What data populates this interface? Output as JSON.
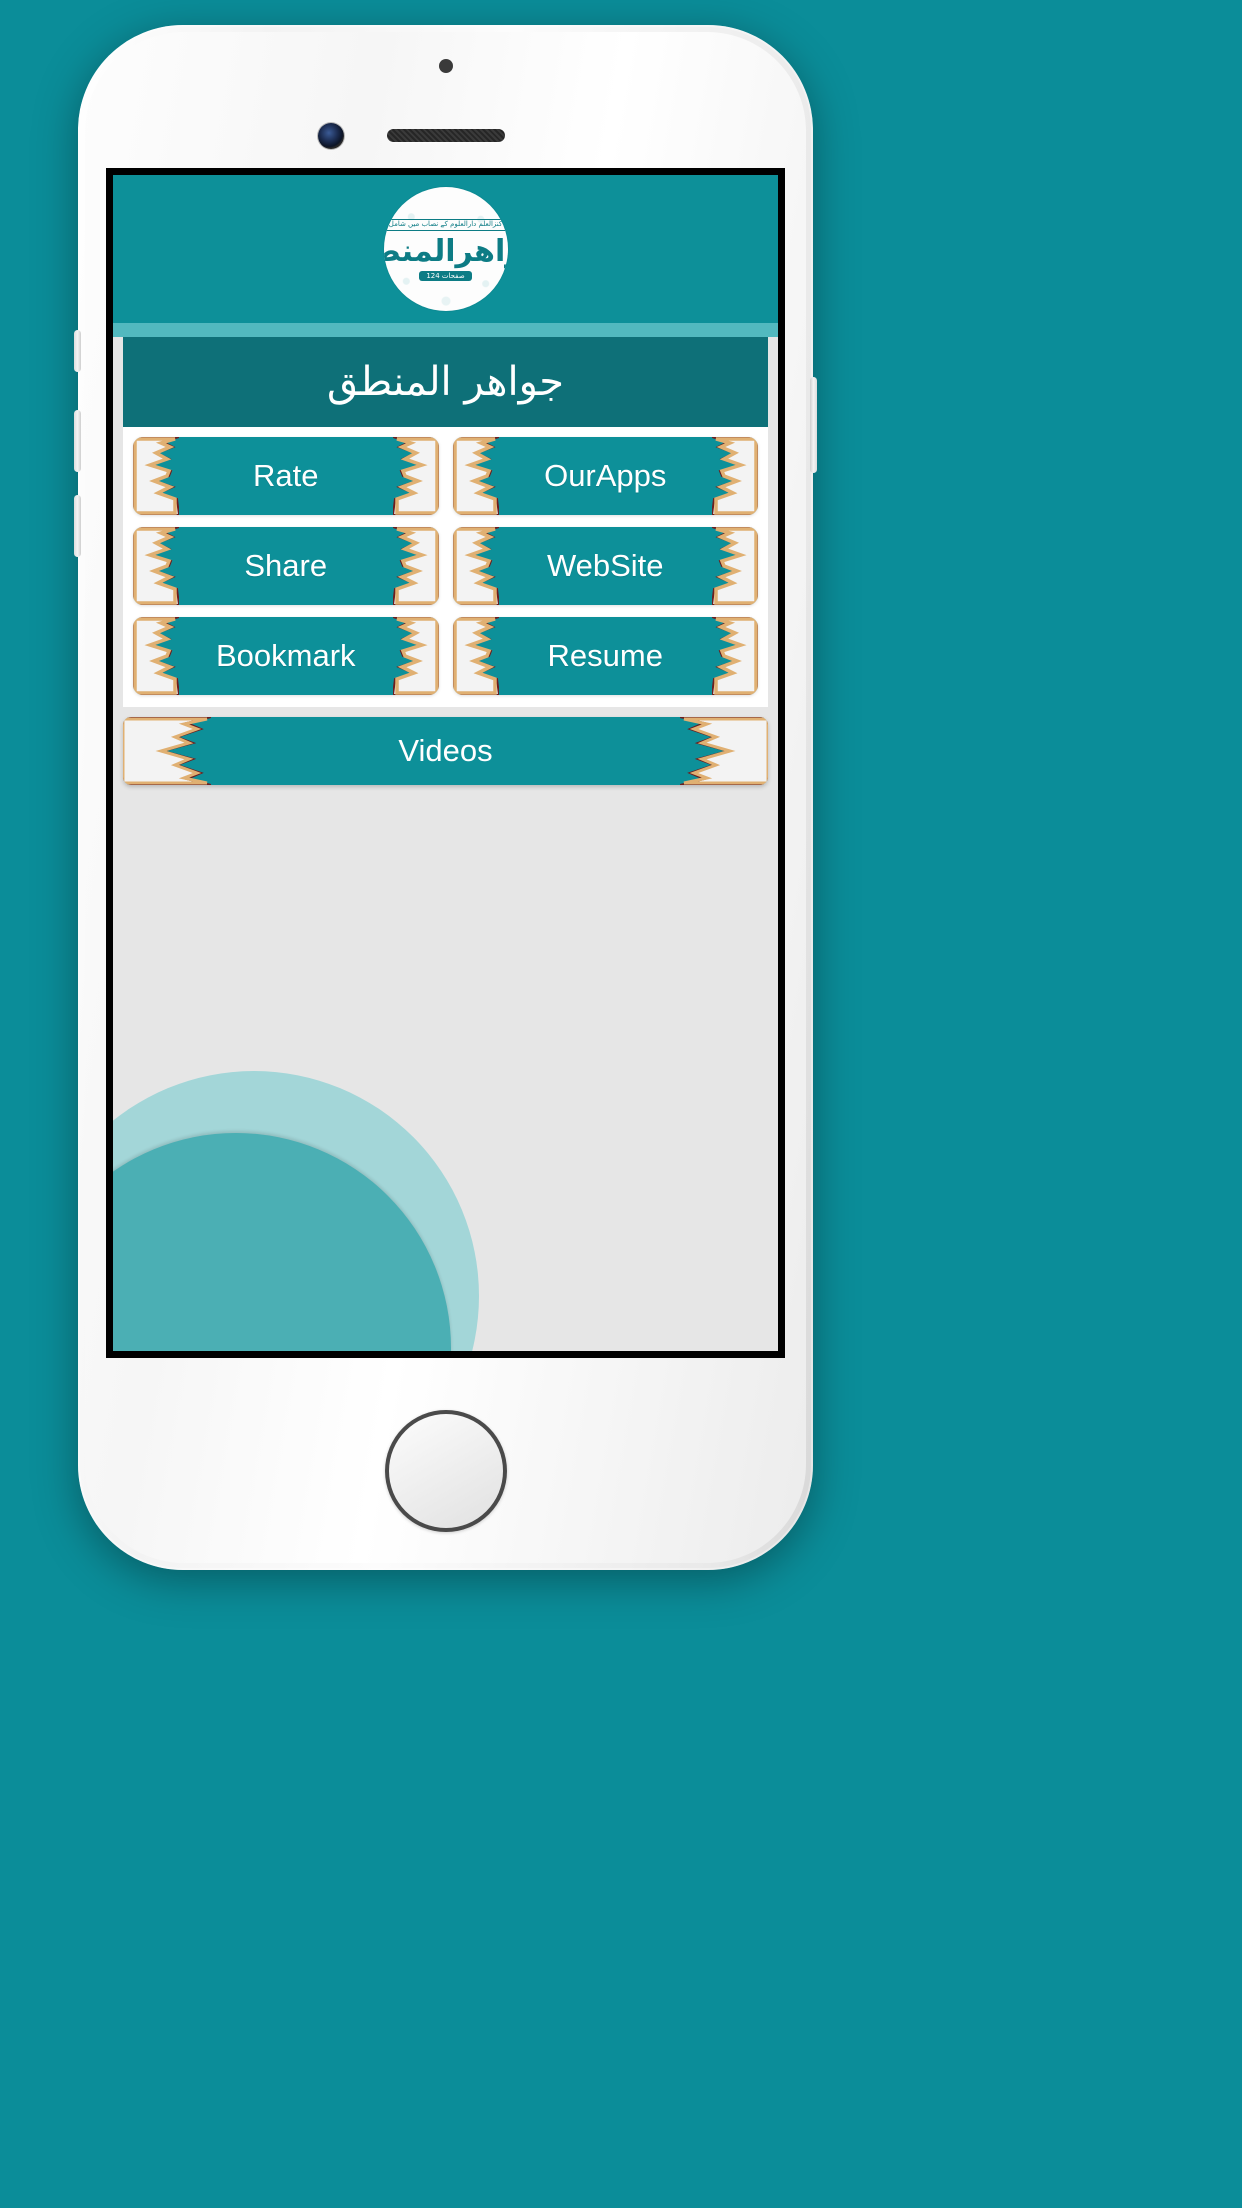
{
  "app": {
    "title_urdu": "جواهر المنطق",
    "logo": {
      "top_banner_text": "كنزالعلم دارالعلوم كے نصاب میں شامل",
      "main_text": "جواهرالمنطق",
      "bottom_badge_text": "صفحات 124"
    }
  },
  "menu": {
    "rows": [
      [
        {
          "label": "Rate",
          "name": "rate-button"
        },
        {
          "label": "OurApps",
          "name": "ourapps-button"
        }
      ],
      [
        {
          "label": "Share",
          "name": "share-button"
        },
        {
          "label": "WebSite",
          "name": "website-button"
        }
      ],
      [
        {
          "label": "Bookmark",
          "name": "bookmark-button"
        },
        {
          "label": "Resume",
          "name": "resume-button"
        }
      ]
    ],
    "videos": {
      "label": "Videos"
    }
  },
  "theme": {
    "teal": "#0d9099",
    "teal_dark": "#0e7078",
    "teal_accent": "#52b9bf",
    "gold": "#e0b072",
    "maroon": "#6b1f20",
    "screen_bg": "#e6e6e6",
    "page_bg": "#0b8d99",
    "circle_outer": "#a3d6d8",
    "circle_inner": "#4bafb4"
  },
  "device": {
    "icons": {
      "earpiece": "speaker-grille-icon",
      "camera": "front-camera-icon",
      "sensor": "proximity-sensor-icon",
      "home": "home-button-icon"
    }
  }
}
